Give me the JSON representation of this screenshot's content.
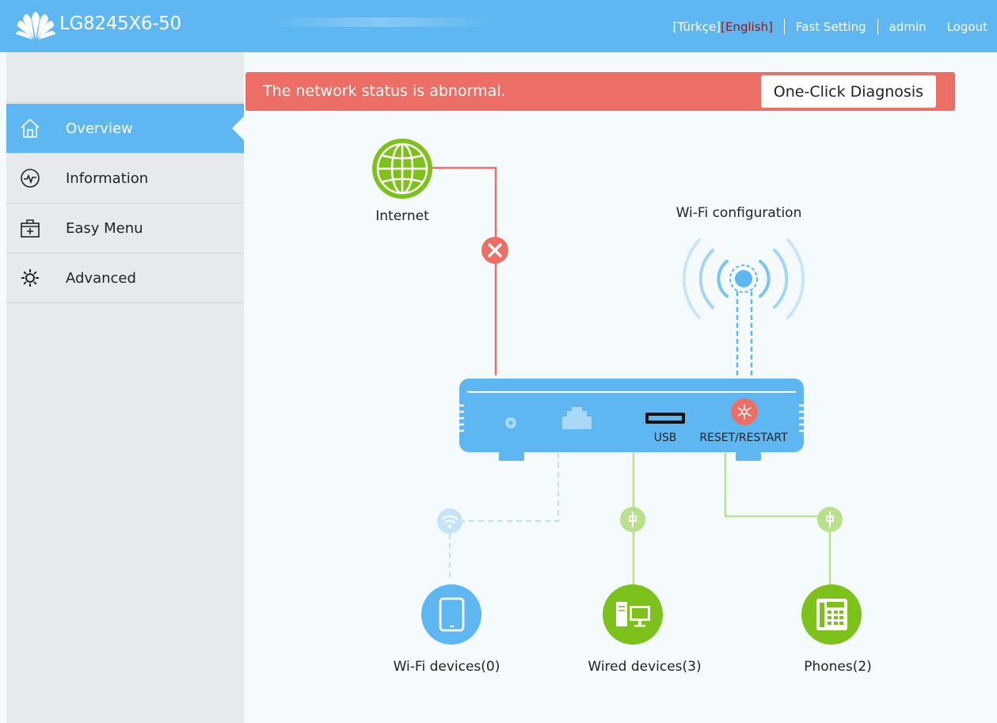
{
  "header": {
    "product_name": "LG8245X6-50",
    "lang_turkish": "[Türkçe]",
    "lang_english": "[English]",
    "fast_setting": "Fast Setting",
    "user": "admin",
    "logout": "Logout",
    "bg_color": "#5eb7f0",
    "active_lang_color": "#8b1b1b"
  },
  "sidebar": {
    "items": [
      {
        "label": "Overview",
        "icon": "home-icon",
        "active": true
      },
      {
        "label": "Information",
        "icon": "pulse-icon",
        "active": false
      },
      {
        "label": "Easy Menu",
        "icon": "toolbox-icon",
        "active": false
      },
      {
        "label": "Advanced",
        "icon": "gear-icon",
        "active": false
      }
    ]
  },
  "alert": {
    "message": "The network status is abnormal.",
    "button": "One-Click Diagnosis",
    "color": "#ec6e64"
  },
  "topology": {
    "internet_label": "Internet",
    "internet_status": "error",
    "wifi_config_label": "Wi-Fi configuration",
    "usb_label": "USB",
    "reset_label": "RESET/RESTART",
    "wifi_devices_label": "Wi-Fi devices(0)",
    "wired_devices_label": "Wired devices(3)",
    "phones_label": "Phones(2)",
    "colors": {
      "internet": "#7cc21a",
      "error": "#ec6e64",
      "router": "#5eb7f0",
      "wired": "#7cc21a",
      "wifi_device": "#5eb7f0"
    }
  }
}
